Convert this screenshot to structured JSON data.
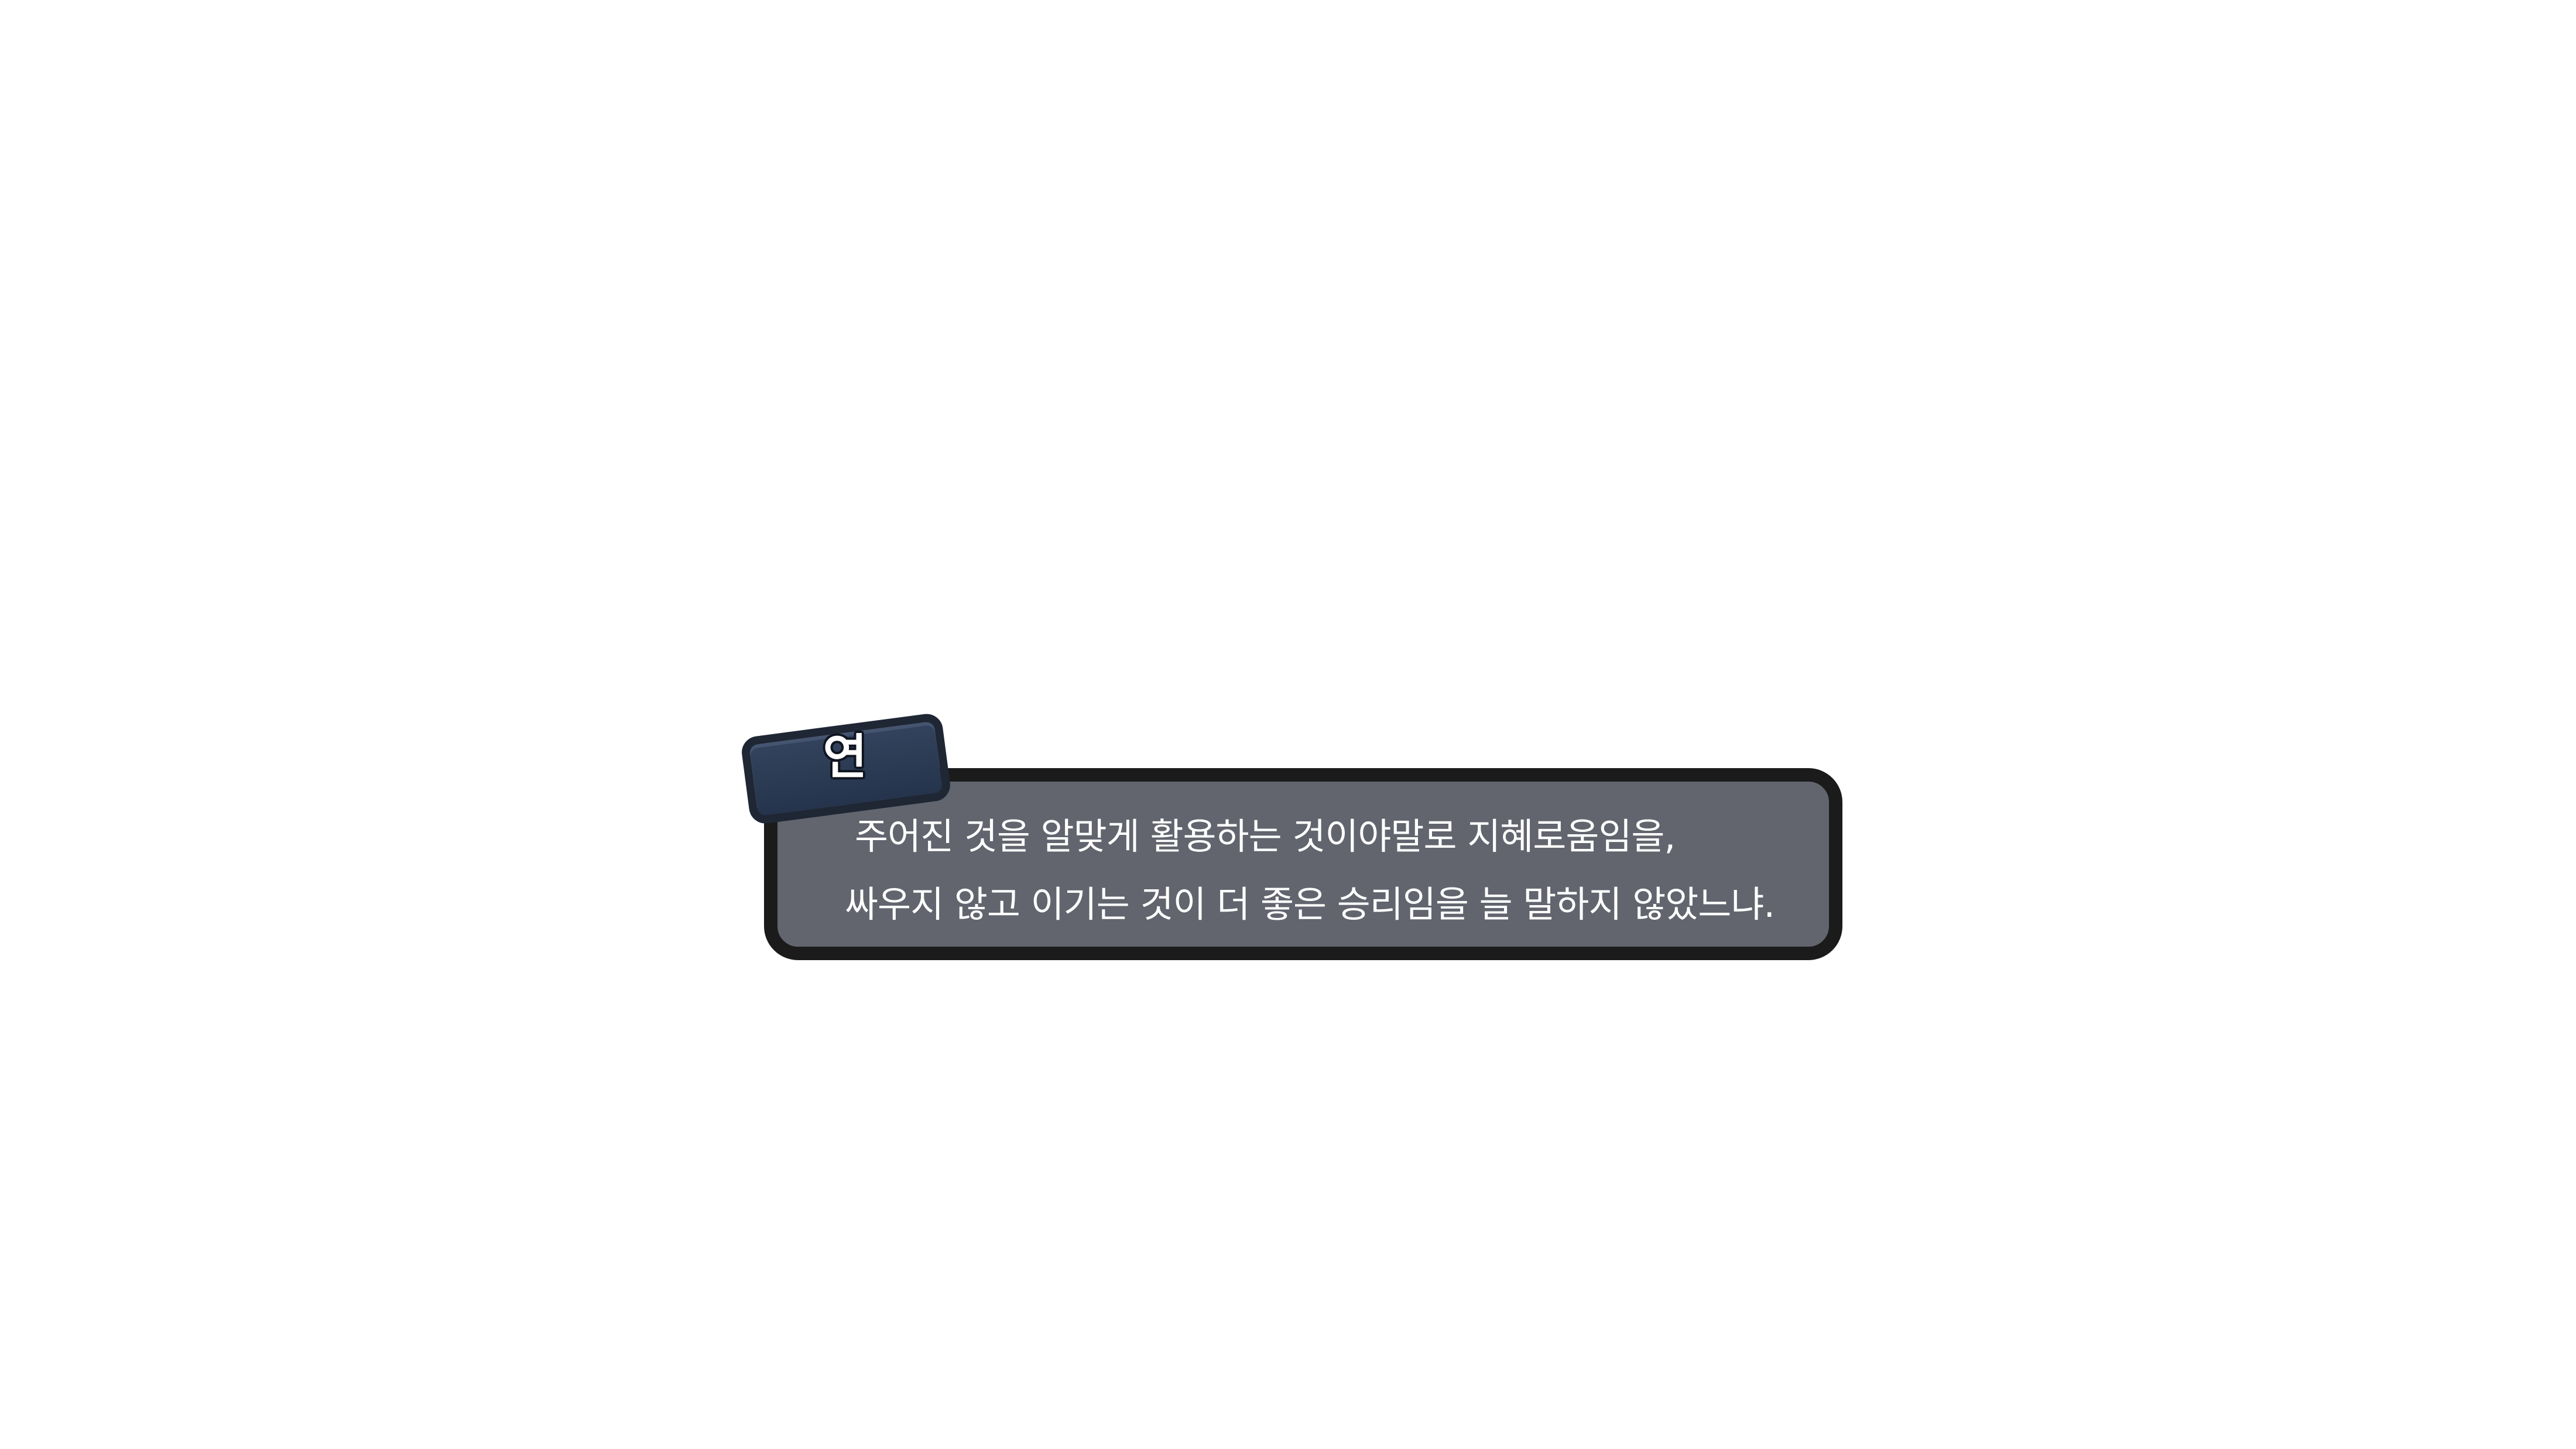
{
  "dialog": {
    "speaker": "연",
    "lines": [
      "주어진 것을 알맞게 활용하는 것이야말로 지혜로움임을,",
      "싸우지 않고 이기는 것이 더 좋은 승리임을 늘 말하지 않았느냐."
    ]
  },
  "colors": {
    "background": "#ffffff",
    "dialog_fill": "#62656e",
    "dialog_border": "#1b1b1c",
    "name_tag_fill": "#2c3a52",
    "name_tag_border": "#1f2634",
    "text": "#ffffff"
  }
}
